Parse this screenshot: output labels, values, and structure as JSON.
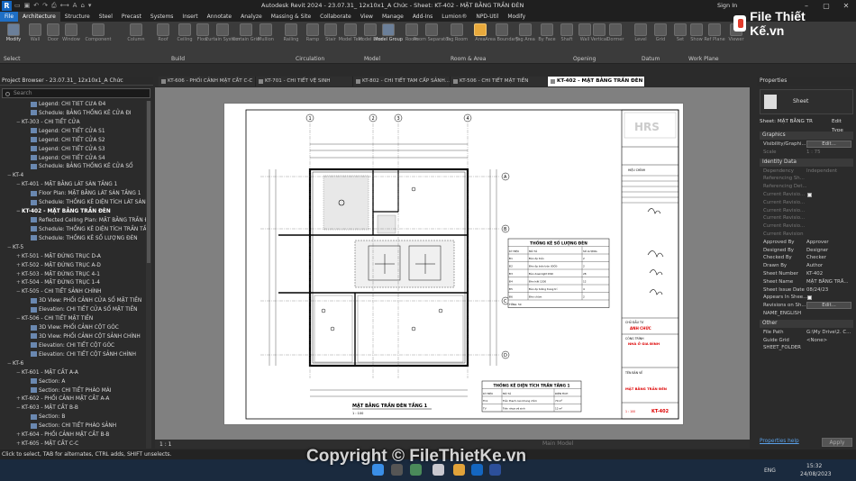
{
  "titlebar": {
    "app_letter": "R",
    "title": "Autodesk Revit 2024 - 23.07.31_ 12x10x1_A Chức - Sheet: KT-402 - MẶT BẰNG TRẦN ĐÈN",
    "signin": "Sign In"
  },
  "ribbon_tabs": [
    "File",
    "Architecture",
    "Structure",
    "Steel",
    "Precast",
    "Systems",
    "Insert",
    "Annotate",
    "Analyze",
    "Massing & Site",
    "Collaborate",
    "View",
    "Manage",
    "Add-Ins",
    "Lumion®",
    "NPD-Util",
    "Modify"
  ],
  "ribbon": {
    "buttons": [
      "Modify",
      "Wall",
      "Door",
      "Window",
      "Component",
      "Column",
      "Roof",
      "Ceiling",
      "Floor",
      "Curtain System",
      "Curtain Grid",
      "Mullion",
      "Railing",
      "Ramp",
      "Stair",
      "Model Text",
      "Model Line",
      "Model Group",
      "Room",
      "Room Separator",
      "Tag Room",
      "Area",
      "Area Boundary",
      "Tag Area",
      "By Face",
      "Shaft",
      "Wall",
      "Vertical",
      "Dormer",
      "Level",
      "Grid",
      "Set",
      "Show",
      "Ref Plane",
      "Viewer"
    ],
    "groups": [
      "Select",
      "Build",
      "Circulation",
      "Model",
      "Room & Area",
      "Opening",
      "Datum",
      "Work Plane"
    ]
  },
  "project_browser": {
    "title": "Project Browser - 23.07.31_ 12x10x1_A Chức",
    "search_placeholder": "Search",
    "items": [
      {
        "label": "Legend: CHI TIẾT CỬA Đ4",
        "level": 3
      },
      {
        "label": "Schedule: BẢNG THỐNG KÊ CỬA ĐI",
        "level": 3
      },
      {
        "label": "KT-303 - CHI TIẾT CỬA",
        "level": 2,
        "exp": "−"
      },
      {
        "label": "Legend: CHI TIẾT CỬA S1",
        "level": 3
      },
      {
        "label": "Legend: CHI TIẾT CỬA S2",
        "level": 3
      },
      {
        "label": "Legend: CHI TIẾT CỬA S3",
        "level": 3
      },
      {
        "label": "Legend: CHI TIẾT CỬA S4",
        "level": 3
      },
      {
        "label": "Schedule: BẢNG THỐNG KÊ CỬA SỔ",
        "level": 3
      },
      {
        "label": "KT-4",
        "level": 1,
        "exp": "−"
      },
      {
        "label": "KT-401 - MẶT BẰNG LÁT SÀN TẦNG 1",
        "level": 2,
        "exp": "−"
      },
      {
        "label": "Floor Plan: MẶT BẰNG LÁT SÀN TẦNG 1",
        "level": 3
      },
      {
        "label": "Schedule: THỐNG KÊ DIỆN TÍCH LÁT SÀN TẦ",
        "level": 3
      },
      {
        "label": "KT-402 - MẶT BẰNG TRẦN ĐÈN",
        "level": 2,
        "exp": "−",
        "bold": true
      },
      {
        "label": "Reflected Ceiling Plan: MẶT BẰNG TRẦN ĐÈ",
        "level": 3
      },
      {
        "label": "Schedule: THỐNG KÊ DIỆN TÍCH TRẦN TẦNG",
        "level": 3
      },
      {
        "label": "Schedule: THỐNG KÊ SỐ LƯỢNG ĐÈN",
        "level": 3
      },
      {
        "label": "KT-5",
        "level": 1,
        "exp": "−"
      },
      {
        "label": "KT-501 - MẶT ĐỨNG TRỤC D-A",
        "level": 2,
        "exp": "+"
      },
      {
        "label": "KT-502 - MẶT ĐỨNG TRỤC A-D",
        "level": 2,
        "exp": "+"
      },
      {
        "label": "KT-503 - MẶT ĐỨNG TRỤC 4-1",
        "level": 2,
        "exp": "+"
      },
      {
        "label": "KT-504 - MẶT ĐỨNG TRỤC 1-4",
        "level": 2,
        "exp": "+"
      },
      {
        "label": "KT-505 - CHI TIẾT SẢNH CHÍNH",
        "level": 2,
        "exp": "−"
      },
      {
        "label": "3D View: PHỐI CẢNH CỬA SỔ MẶT TIỀN",
        "level": 3
      },
      {
        "label": "Elevation: CHI TIẾT CỬA SỔ MẶT TIỀN",
        "level": 3
      },
      {
        "label": "KT-506 - CHI TIẾT MẶT TIỀN",
        "level": 2,
        "exp": "−"
      },
      {
        "label": "3D View: PHỐI CẢNH CỘT GÓC",
        "level": 3
      },
      {
        "label": "3D View: PHỐI CẢNH CỘT SẢNH CHÍNH",
        "level": 3
      },
      {
        "label": "Elevation: CHI TIẾT CỘT GÓC",
        "level": 3
      },
      {
        "label": "Elevation: CHI TIẾT CỘT SẢNH CHÍNH",
        "level": 3
      },
      {
        "label": "KT-6",
        "level": 1,
        "exp": "−"
      },
      {
        "label": "KT-601 - MẶT CẮT A-A",
        "level": 2,
        "exp": "−"
      },
      {
        "label": "Section: A",
        "level": 3
      },
      {
        "label": "Section: CHI TIẾT PHÀO MÁI",
        "level": 3
      },
      {
        "label": "KT-602 - PHỐI CẢNH MẶT CẮT A-A",
        "level": 2,
        "exp": "+"
      },
      {
        "label": "KT-603 - MẶT CẮT B-B",
        "level": 2,
        "exp": "−"
      },
      {
        "label": "Section: B",
        "level": 3
      },
      {
        "label": "Section: CHI TIẾT PHÀO SẢNH",
        "level": 3
      },
      {
        "label": "KT-604 - PHỐI CẢNH MẶT CẮT B-B",
        "level": 2,
        "exp": "+"
      },
      {
        "label": "KT-605 - MẶT CẮT C-C",
        "level": 2,
        "exp": "+"
      }
    ]
  },
  "view_tabs": [
    "KT-606 - PHỐI CẢNH MẶT CẮT C-C",
    "KT-701 - CHI TIẾT VỆ SINH",
    "KT-802 - CHI TIẾT TAM CẤP SẢNH...",
    "KT-506 - CHI TIẾT MẶT TIỀN",
    "KT-402 - MẶT BẰNG TRẦN ĐÈN"
  ],
  "drawing": {
    "grid_numbers": [
      "1",
      "2",
      "3",
      "4"
    ],
    "grid_letters": [
      "A",
      "B",
      "C",
      "D"
    ],
    "plan_title": "MẶT BẰNG TRẦN ĐÈN TẦNG 1",
    "plan_scale": "1 : 100",
    "light_schedule": {
      "title": "THỐNG KÊ SỐ LƯỢNG ĐÈN",
      "headers": [
        "KÝ HIỆU",
        "MÔ TẢ",
        "SỐ LƯỢNG"
      ],
      "rows": [
        [
          "Đ1",
          "Đèn ốp trần",
          "2"
        ],
        [
          "Đ2",
          "Đèn ốp trần tròn (ĐỐI)",
          "2"
        ],
        [
          "Đ3",
          "Đèn downlight D90",
          "28"
        ],
        [
          "Đ4",
          "Đèn hắt 1200",
          "12"
        ],
        [
          "Đ5",
          "Đèn ốp tường trang trí",
          "4"
        ],
        [
          "Đ6",
          "Đèn chùm",
          "2"
        ]
      ],
      "total": "TỔNG: 50"
    },
    "ceiling_schedule": {
      "title": "THỐNG KÊ DIỆN TÍCH TRẦN TẦNG 1",
      "headers": [
        "KÝ HIỆU",
        "MÔ TẢ",
        "DIỆN TÍCH"
      ],
      "rows": [
        [
          "TC1",
          "Trần thạch cao khung chìm",
          "70 m²"
        ],
        [
          "TV",
          "Trần nhựa vệ sinh",
          "12 m²"
        ]
      ]
    },
    "title_block": {
      "revision_label": "HIỆU CHỈNH",
      "owner_label": "CHỦ ĐẦU TƯ",
      "owner_name": "ANH CHỨC",
      "project_label": "CÔNG TRÌNH",
      "project_name": "NHÀ Ở GIA ĐÌNH",
      "sheet_name_label": "TÊN BẢN VẼ",
      "sheet_name": "MẶT BẰNG TRẦN ĐÈN",
      "sheet_scale": "1 : 100",
      "sheet_number": "KT-402"
    }
  },
  "view_status": {
    "scale": "1 : 1",
    "main_model": "Main Model"
  },
  "properties": {
    "title": "Properties",
    "type": "Sheet",
    "selector": "Sheet: MẶT BẰNG TR",
    "edit_type": "Edit Type",
    "sections": [
      {
        "name": "Graphics",
        "rows": [
          {
            "k": "Visibility/Graphi...",
            "v": "Edit...",
            "kind": "button"
          },
          {
            "k": "Scale",
            "v": "1 : 75",
            "dim": true
          }
        ]
      },
      {
        "name": "Identity Data",
        "rows": [
          {
            "k": "Dependency",
            "v": "Independent",
            "dim": true
          },
          {
            "k": "Referencing Sh...",
            "v": "",
            "dim": true
          },
          {
            "k": "Referencing Det...",
            "v": "",
            "dim": true
          },
          {
            "k": "Current Revisio...",
            "v": "",
            "kind": "checkbox",
            "dim": true
          },
          {
            "k": "Current Revisio...",
            "v": "",
            "dim": true
          },
          {
            "k": "Current Revisio...",
            "v": "",
            "dim": true
          },
          {
            "k": "Current Revisio...",
            "v": "",
            "dim": true
          },
          {
            "k": "Current Revisio...",
            "v": "",
            "dim": true
          },
          {
            "k": "Current Revision",
            "v": "",
            "dim": true
          },
          {
            "k": "Approved By",
            "v": "Approver"
          },
          {
            "k": "Designed By",
            "v": "Designer"
          },
          {
            "k": "Checked By",
            "v": "Checker"
          },
          {
            "k": "Drawn By",
            "v": "Author"
          },
          {
            "k": "Sheet Number",
            "v": "KT-402"
          },
          {
            "k": "Sheet Name",
            "v": "MẶT BẰNG TRẦ..."
          },
          {
            "k": "Sheet Issue Date",
            "v": "08/24/23"
          },
          {
            "k": "Appears In Shee...",
            "v": "",
            "kind": "checkbox"
          },
          {
            "k": "Revisions on Sh...",
            "v": "Edit...",
            "kind": "button"
          },
          {
            "k": "NAME_ENGLISH",
            "v": ""
          }
        ]
      },
      {
        "name": "Other",
        "rows": [
          {
            "k": "File Path",
            "v": "G:\\My Drive\\2. C..."
          },
          {
            "k": "Guide Grid",
            "v": "<None>"
          },
          {
            "k": "SHEET_FOLDER",
            "v": ""
          }
        ]
      }
    ],
    "help": "Properties help",
    "apply": "Apply"
  },
  "app_status": "Click to select, TAB for alternates, CTRL adds, SHIFT unselects.",
  "taskbar": {
    "lang": "ENG",
    "time": "15:32",
    "date": "24/08/2023"
  },
  "watermarks": {
    "logo_text": "File Thiết Kế.vn",
    "copyright": "Copyright © FileThietKe.vn"
  }
}
